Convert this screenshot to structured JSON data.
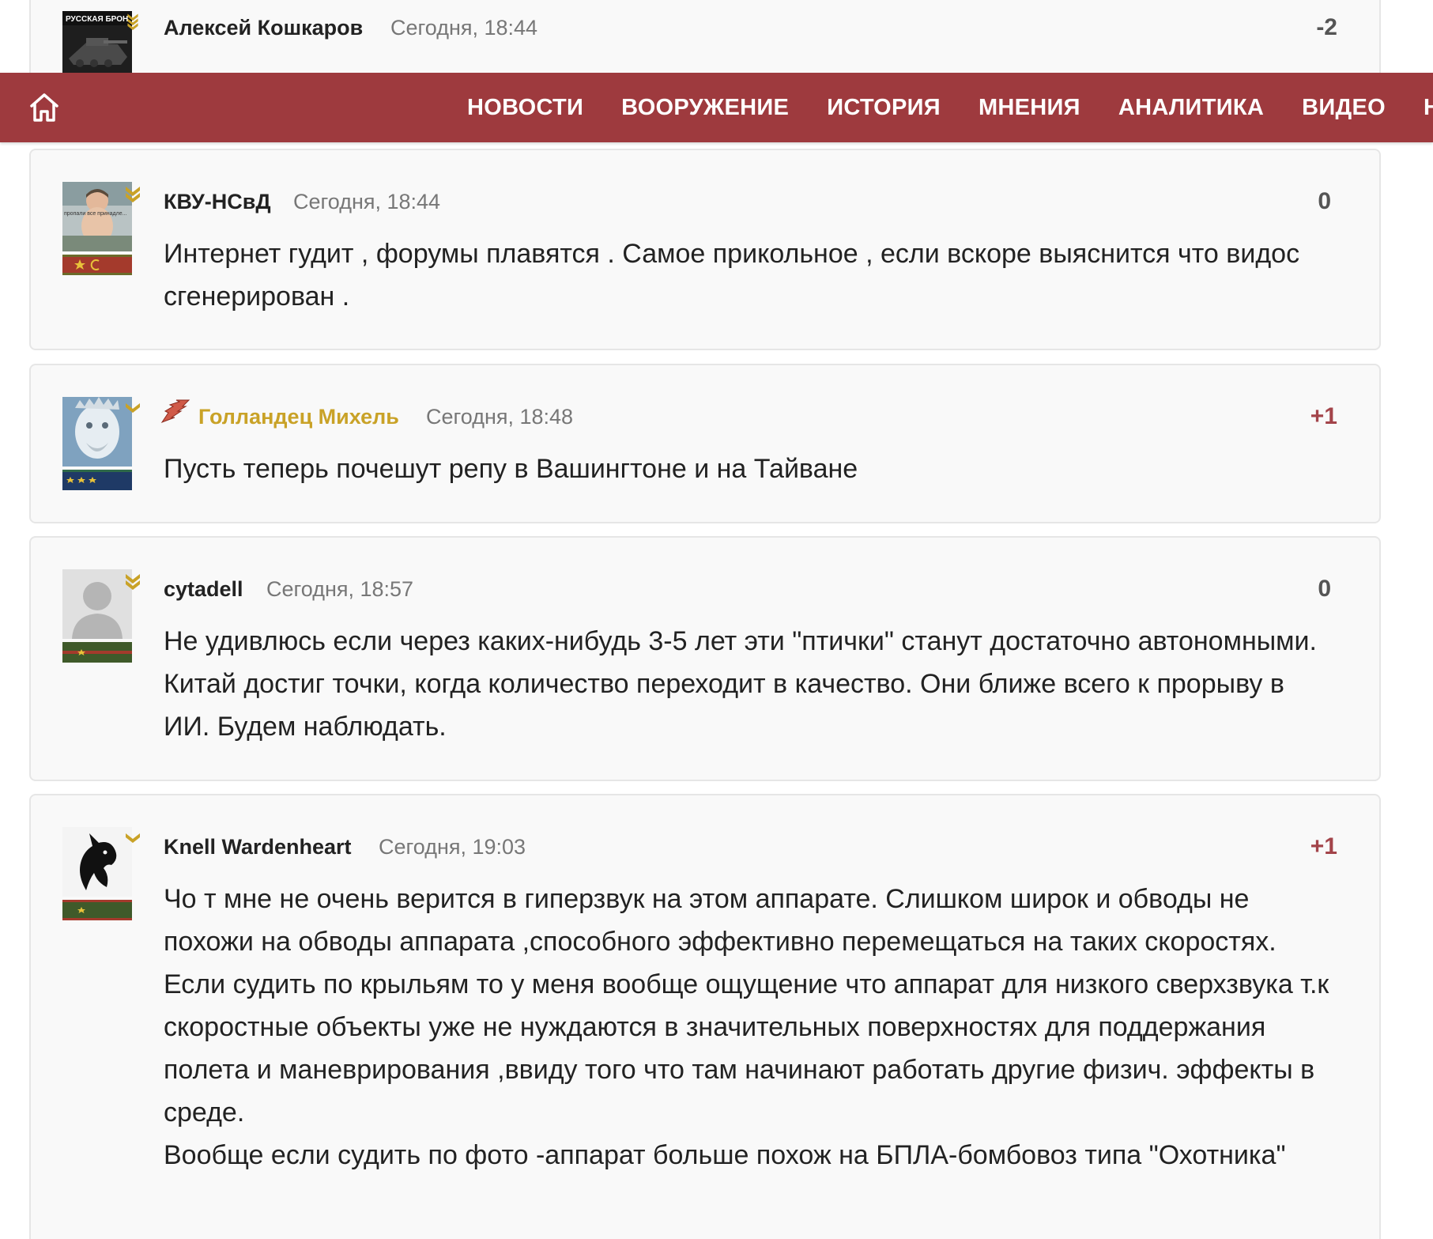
{
  "nav": {
    "items": [
      "НОВОСТИ",
      "ВООРУЖЕНИЕ",
      "ИСТОРИЯ",
      "МНЕНИЯ",
      "АНАЛИТИКА",
      "ВИДЕО",
      "НОВ"
    ],
    "home_icon": "home-icon",
    "background": "#9e3a3e"
  },
  "comments": [
    {
      "author": "Алексей Кошкаров",
      "time": "Сегодня, 18:44",
      "score": "-2",
      "text": "",
      "avatar_text": "РУССКАЯ БРОН"
    },
    {
      "author": "КВУ-НСвД",
      "time": "Сегодня, 18:44",
      "score": "0",
      "text": "Интернет гудит , форумы плавятся . Самое прикольное , если вскоре выяснится что видос сгенерирован .",
      "avatar_text": "пропали все принадле..."
    },
    {
      "author": "Голландец Михель",
      "time": "Сегодня, 18:48",
      "score": "+1",
      "text": "Пусть теперь почешут репу в Вашингтоне и на Тайване",
      "avatar_text": ""
    },
    {
      "author": "cytadell",
      "time": "Сегодня, 18:57",
      "score": "0",
      "text": "Не удивлюсь если через каких-нибудь 3-5 лет эти \"птички\" станут достаточно автономными. Китай достиг точки, когда количество переходит в качество. Они ближе всего к прорыву в ИИ. Будем наблюдать.",
      "avatar_text": ""
    },
    {
      "author": "Knell Wardenheart",
      "time": "Сегодня, 19:03",
      "score": "+1",
      "text": "Чо т мне не очень верится в гиперзвук на этом аппарате. Слишком широк и обводы не похожи на обводы аппарата ,способного эффективно перемещаться на таких скоростях. Если судить по крыльям то у меня вообще ощущение что аппарат для низкого сверхзвука т.к скоростные объекты уже не нуждаются в значительных поверхностях для поддержания полета и маневрирования ,ввиду того что там начинают работать другие физич. эффекты в среде.\nВообще если судить по фото -аппарат больше похож на БПЛА-бомбовоз типа \"Охотника\"",
      "avatar_text": ""
    }
  ]
}
